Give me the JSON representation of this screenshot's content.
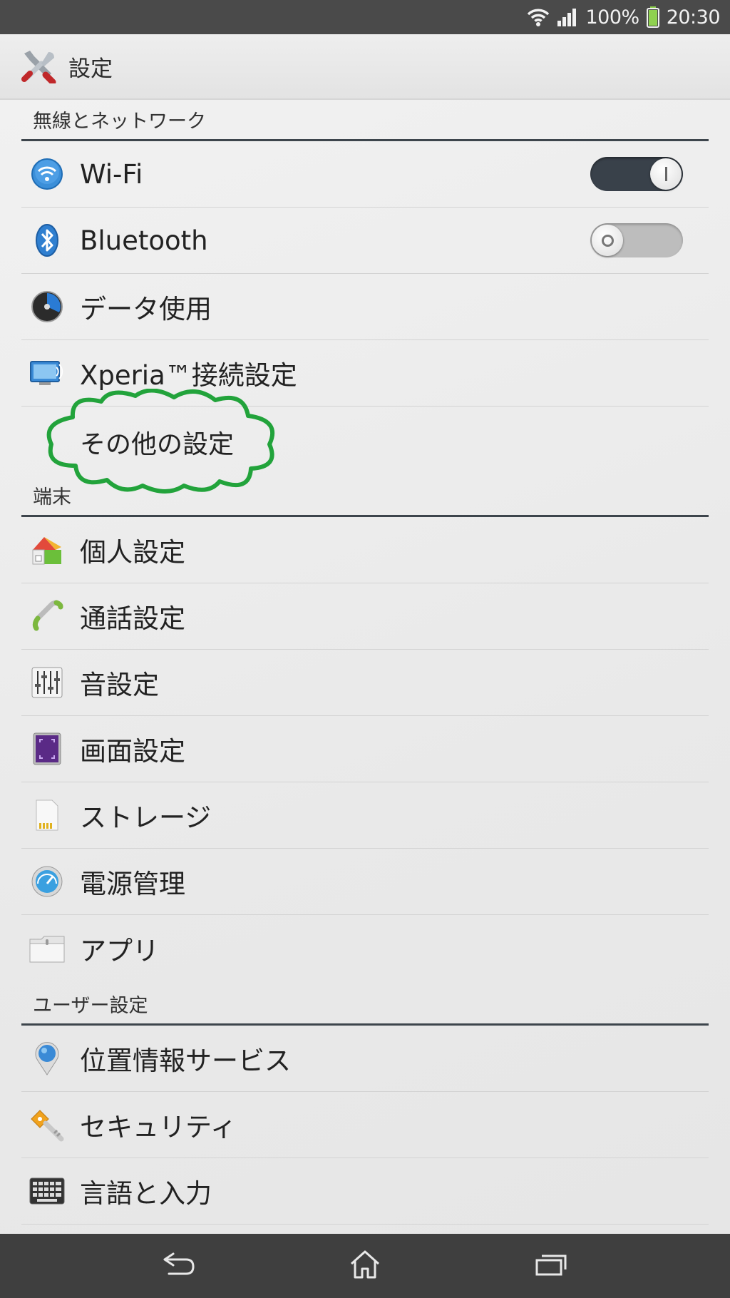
{
  "status_bar": {
    "battery_text": "100%",
    "time": "20:30",
    "icons": [
      "wifi-icon",
      "signal-icon",
      "battery-icon"
    ]
  },
  "action_bar": {
    "title": "設定",
    "icon": "tools-icon"
  },
  "sections": {
    "wireless": "無線とネットワーク",
    "device": "端末",
    "user": "ユーザー設定"
  },
  "items": {
    "wifi": {
      "label": "Wi-Fi",
      "icon": "wifi-icon",
      "toggle": "on"
    },
    "bluetooth": {
      "label": "Bluetooth",
      "icon": "bluetooth-icon",
      "toggle": "off"
    },
    "data_usage": {
      "label": "データ使用",
      "icon": "data-usage-icon"
    },
    "xperia_connect": {
      "label": "Xperia™接続設定",
      "icon": "xperia-connect-icon"
    },
    "more": {
      "label": "その他の設定"
    },
    "personal": {
      "label": "個人設定",
      "icon": "personalization-icon"
    },
    "call": {
      "label": "通話設定",
      "icon": "phone-handset-icon"
    },
    "sound": {
      "label": "音設定",
      "icon": "equalizer-icon"
    },
    "display": {
      "label": "画面設定",
      "icon": "display-icon"
    },
    "storage": {
      "label": "ストレージ",
      "icon": "sd-card-icon"
    },
    "power": {
      "label": "電源管理",
      "icon": "power-gauge-icon"
    },
    "apps": {
      "label": "アプリ",
      "icon": "folder-icon"
    },
    "location": {
      "label": "位置情報サービス",
      "icon": "location-pin-icon"
    },
    "security": {
      "label": "セキュリティ",
      "icon": "key-icon"
    },
    "language": {
      "label": "言語と入力",
      "icon": "keyboard-icon"
    }
  },
  "nav_bar": {
    "buttons": [
      "back-icon",
      "home-icon",
      "recents-icon"
    ]
  },
  "colors": {
    "status_bar_bg": "#4a4a4a",
    "section_rule": "#3d454c",
    "annotation_green": "#22a33b",
    "nav_bar_bg": "#3f3f3f"
  }
}
